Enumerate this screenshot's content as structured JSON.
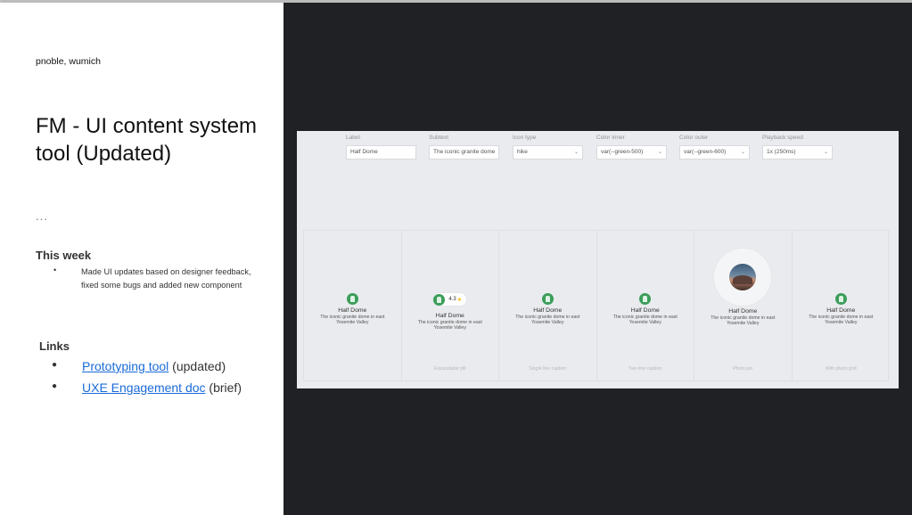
{
  "slide": {
    "authors": "pnoble, wumich",
    "title": "FM - UI content system tool (Updated)",
    "ellipsis": "...",
    "this_week": {
      "heading": "This week",
      "bullet": "•",
      "items": [
        "Made UI updates based on designer feedback, fixed some bugs and added new component"
      ]
    },
    "links": {
      "heading": "Links",
      "bullet": "●",
      "items": [
        {
          "link_text": "Prototyping tool",
          "suffix": " (updated)"
        },
        {
          "link_text": "UXE Engagement doc",
          "suffix": " (brief)"
        }
      ]
    }
  },
  "tool": {
    "controls": [
      {
        "label": "Label",
        "value": "Half Dome"
      },
      {
        "label": "Subtext",
        "value": "The iconic granite dome"
      },
      {
        "label": "Icon type",
        "value": "hike"
      },
      {
        "label": "Color inner",
        "value": "var(--green-500)"
      },
      {
        "label": "Color outer",
        "value": "var(--green-600)"
      },
      {
        "label": "Playback speed",
        "value": "1x (250ms)"
      }
    ],
    "chevron": "⌄",
    "cards": [
      {
        "name": "Half Dome",
        "subtext": "The iconic granite dome in east Yosemite Valley",
        "caption": ""
      },
      {
        "name": "Half Dome",
        "subtext": "The iconic granite dome in east Yosemite Valley",
        "caption": "Expandable pill",
        "rating": "4.3",
        "star": "★"
      },
      {
        "name": "Half Dome",
        "subtext": "The iconic granite dome in east Yosemite Valley",
        "caption": "Single line caption"
      },
      {
        "name": "Half Dome",
        "subtext": "The iconic granite dome in east Yosemite Valley",
        "caption": "Two line caption"
      },
      {
        "name": "Half Dome",
        "subtext": "The iconic granite dome in east Yosemite Valley",
        "caption": "Photo pin"
      },
      {
        "name": "Half Dome",
        "subtext": "The iconic granite dome in east Yosemite Valley",
        "caption": "With photo grid"
      }
    ],
    "colors": {
      "pin": "#3b9d5a",
      "dark_bg": "#202124",
      "link": "#1a6bd8"
    }
  }
}
